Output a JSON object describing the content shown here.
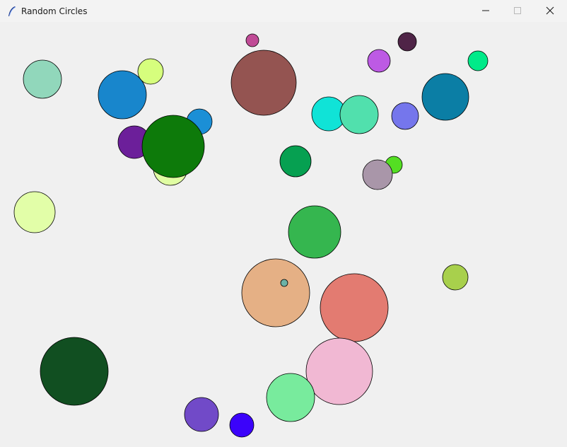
{
  "window": {
    "title": "Random Circles",
    "app_icon": "feather-icon",
    "controls": {
      "minimize_icon": "minimize-icon",
      "maximize_icon": "maximize-icon",
      "close_icon": "close-icon"
    }
  },
  "canvas": {
    "background": "#f0f0f0",
    "outline_color": "#000000",
    "circle_fills": [
      "#91d7bb",
      "#1886cc",
      "#d6fe7d",
      "#e0fda3",
      "#e2fea8",
      "#1b8fd6",
      "#6c1f9a",
      "#0d7a0a",
      "#c04b96",
      "#945451",
      "#4f2447",
      "#bd5ae4",
      "#00ea89",
      "#10e3d7",
      "#51e0ad",
      "#7576ec",
      "#0b7ea5",
      "#06a051",
      "#54de23",
      "#a996a9",
      "#35b64f",
      "#e5b085",
      "#6cb2a6",
      "#e37b71",
      "#a8d04c",
      "#114f21",
      "#f1b8d3",
      "#78eb9d",
      "#714ac8",
      "#3b03fa"
    ]
  }
}
